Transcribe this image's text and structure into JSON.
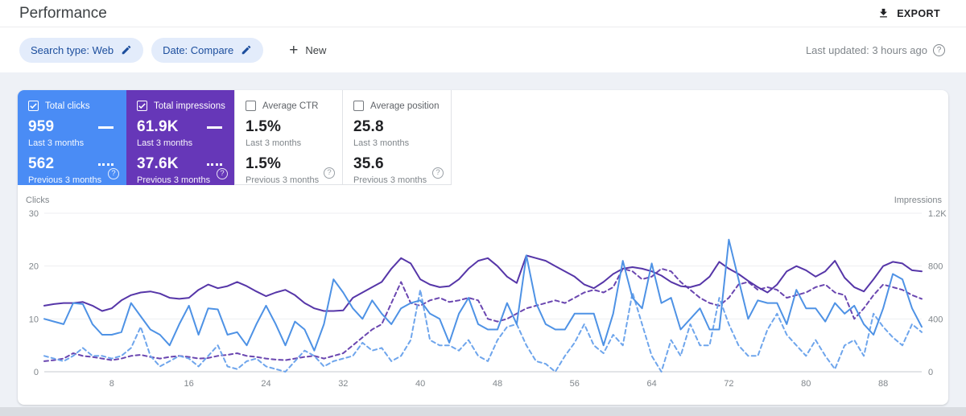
{
  "page": {
    "title": "Performance",
    "export_label": "EXPORT",
    "last_updated": "Last updated: 3 hours ago",
    "help_glyph": "?"
  },
  "filters": {
    "chips": [
      {
        "label": "Search type: Web"
      },
      {
        "label": "Date: Compare"
      }
    ],
    "new_label": "New",
    "plus_glyph": "+"
  },
  "metric_cards": [
    {
      "label": "Total clicks",
      "checked": true,
      "primary": "959",
      "primary_caption": "Last 3 months",
      "secondary": "562",
      "secondary_caption": "Previous 3 months",
      "bg": "#4a8cf5",
      "help_glyph": "?"
    },
    {
      "label": "Total impressions",
      "checked": true,
      "primary": "61.9K",
      "primary_caption": "Last 3 months",
      "secondary": "37.6K",
      "secondary_caption": "Previous 3 months",
      "bg": "#6637b8",
      "help_glyph": "?"
    },
    {
      "label": "Average CTR",
      "checked": false,
      "primary": "1.5%",
      "primary_caption": "Last 3 months",
      "secondary": "1.5%",
      "secondary_caption": "Previous 3 months",
      "bg": "#ffffff",
      "help_glyph": "?"
    },
    {
      "label": "Average position",
      "checked": false,
      "primary": "25.8",
      "primary_caption": "Last 3 months",
      "secondary": "35.6",
      "secondary_caption": "Previous 3 months",
      "bg": "#ffffff",
      "help_glyph": "?"
    }
  ],
  "chart_data": {
    "type": "line",
    "x_range": [
      1,
      92
    ],
    "x_label_ticks": [
      8,
      16,
      24,
      32,
      40,
      48,
      56,
      64,
      72,
      80,
      88
    ],
    "grid": true,
    "left_axis": {
      "title": "Clicks",
      "lim": [
        0,
        30
      ],
      "ticks": [
        0,
        10,
        20,
        30
      ]
    },
    "right_axis": {
      "title": "Impressions",
      "lim": [
        0,
        1200
      ],
      "ticks": [
        "0",
        "400",
        "800",
        "1.2K"
      ]
    },
    "series": [
      {
        "name": "Impressions - Previous 3 months",
        "axis": "right",
        "style": "dashed",
        "color": "#6a46b0",
        "values": [
          80,
          88,
          100,
          140,
          120,
          112,
          100,
          88,
          100,
          120,
          128,
          112,
          100,
          112,
          120,
          112,
          100,
          104,
          120,
          128,
          140,
          120,
          112,
          100,
          92,
          88,
          100,
          112,
          120,
          100,
          120,
          140,
          200,
          260,
          320,
          360,
          520,
          680,
          520,
          500,
          540,
          560,
          528,
          540,
          560,
          540,
          400,
          380,
          400,
          440,
          480,
          500,
          520,
          540,
          520,
          560,
          600,
          620,
          600,
          640,
          780,
          760,
          700,
          720,
          780,
          760,
          680,
          620,
          560,
          520,
          500,
          560,
          660,
          680,
          620,
          640,
          620,
          560,
          580,
          600,
          640,
          660,
          600,
          580,
          400,
          480,
          580,
          660,
          640,
          620,
          580,
          552
        ]
      },
      {
        "name": "Clicks - Previous 3 months",
        "axis": "left",
        "style": "dashed",
        "color": "#6ea5ec",
        "values": [
          3,
          2.5,
          2,
          3,
          4.5,
          3,
          3,
          2.5,
          3,
          4.5,
          8.5,
          3,
          1,
          2,
          3,
          2.5,
          1,
          3,
          5,
          1,
          0.5,
          2,
          2.5,
          1,
          0.5,
          0,
          2,
          4,
          3,
          1,
          2,
          2.5,
          3,
          5.5,
          4,
          4.5,
          2,
          3,
          6,
          15.5,
          6,
          5,
          5,
          4,
          6,
          3,
          2,
          6,
          8.5,
          9,
          5,
          2,
          1.5,
          0,
          3,
          5.5,
          9,
          5,
          3.5,
          7,
          5,
          15,
          9,
          3,
          0,
          6,
          3,
          9,
          5,
          5,
          14,
          9,
          5,
          3,
          3,
          8,
          11,
          7,
          5,
          3,
          6,
          3,
          0.5,
          5,
          6,
          3,
          11,
          8.5,
          6.5,
          5,
          9,
          7.5
        ]
      },
      {
        "name": "Impressions - Last 3 months",
        "axis": "right",
        "style": "solid",
        "color": "#5636a8",
        "values": [
          500,
          512,
          520,
          520,
          528,
          500,
          460,
          480,
          540,
          580,
          600,
          608,
          592,
          560,
          552,
          560,
          620,
          660,
          632,
          648,
          680,
          648,
          608,
          572,
          600,
          620,
          580,
          520,
          480,
          460,
          460,
          464,
          560,
          600,
          640,
          680,
          780,
          860,
          820,
          700,
          660,
          640,
          648,
          700,
          780,
          840,
          860,
          800,
          720,
          672,
          880,
          860,
          840,
          800,
          760,
          720,
          660,
          632,
          680,
          740,
          780,
          792,
          780,
          760,
          728,
          680,
          648,
          640,
          660,
          720,
          832,
          780,
          740,
          688,
          640,
          600,
          660,
          760,
          800,
          768,
          720,
          760,
          840,
          712,
          640,
          608,
          700,
          800,
          832,
          820,
          768,
          760
        ]
      },
      {
        "name": "Clicks - Last 3 months",
        "axis": "left",
        "style": "solid",
        "color": "#4e92e5",
        "values": [
          10,
          9.5,
          9,
          13,
          12.8,
          9,
          7,
          7,
          7.5,
          13,
          10.5,
          8,
          7,
          5,
          9,
          12.5,
          7,
          12,
          11.8,
          7,
          7.5,
          5,
          9,
          12.5,
          9,
          5,
          9.5,
          8,
          4,
          9,
          17.5,
          15,
          12,
          10,
          13.5,
          11,
          9,
          12,
          13,
          13.5,
          11,
          10,
          5.5,
          11,
          14,
          9,
          8,
          8,
          13,
          9,
          22,
          13,
          9,
          8,
          8,
          11,
          11,
          11,
          5,
          11,
          21,
          14,
          12,
          20.5,
          13,
          14,
          8,
          10,
          12,
          8,
          8,
          25,
          17.5,
          10,
          13.5,
          13,
          13,
          9,
          15.5,
          12,
          12,
          9.5,
          13,
          11,
          12.5,
          9,
          7,
          12,
          18.5,
          17.5,
          12,
          8.5
        ]
      }
    ]
  }
}
